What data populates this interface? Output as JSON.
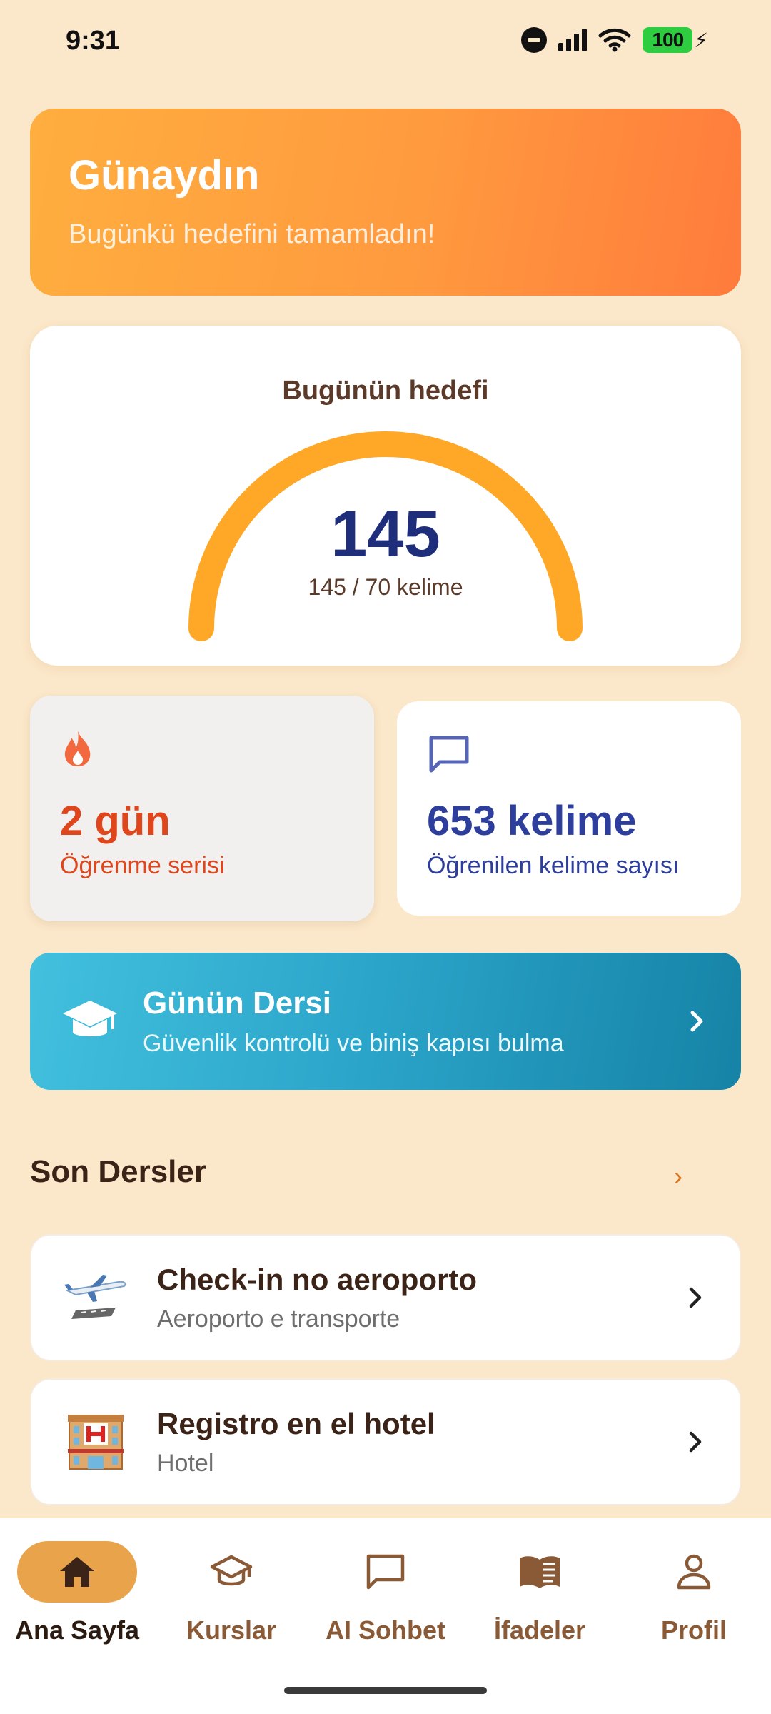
{
  "status_bar": {
    "time": "9:31",
    "battery": "100"
  },
  "greeting": {
    "title": "Günaydın",
    "subtitle": "Bugünkü hedefini tamamladın!"
  },
  "goal": {
    "title": "Bugünün hedefi",
    "value": "145",
    "progress_text": "145 / 70 kelime",
    "progress_fraction": 1.0,
    "accent_color": "#FFA726"
  },
  "stats": {
    "streak": {
      "value": "2 gün",
      "label": "Öğrenme serisi",
      "icon": "flame-icon",
      "color": "#E0461C"
    },
    "words": {
      "value": "653 kelime",
      "label": "Öğrenilen kelime sayısı",
      "icon": "chat-bubble-icon",
      "color": "#2D3E9C"
    }
  },
  "daily_lesson": {
    "title": "Günün Dersi",
    "subtitle": "Güvenlik kontrolü ve biniş kapısı bulma",
    "icon": "graduation-cap-icon"
  },
  "recent": {
    "title": "Son Dersler",
    "more": "›",
    "items": [
      {
        "title": "Check-in no aeroporto",
        "subtitle": "Aeroporto e transporte",
        "icon": "airplane-icon"
      },
      {
        "title": "Registro en el hotel",
        "subtitle": "Hotel",
        "icon": "hotel-icon"
      }
    ]
  },
  "nav": {
    "items": [
      {
        "label": "Ana Sayfa",
        "icon": "home-icon",
        "active": true
      },
      {
        "label": "Kurslar",
        "icon": "courses-icon",
        "active": false
      },
      {
        "label": "AI Sohbet",
        "icon": "chat-icon",
        "active": false
      },
      {
        "label": "İfadeler",
        "icon": "book-icon",
        "active": false
      },
      {
        "label": "Profil",
        "icon": "profile-icon",
        "active": false
      }
    ]
  }
}
